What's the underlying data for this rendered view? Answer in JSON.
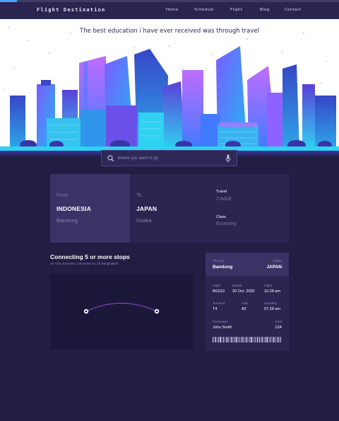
{
  "nav": {
    "brand": "Flight Destination",
    "links": [
      "Home",
      "Schedule",
      "Flight",
      "Blog",
      "Contact"
    ]
  },
  "hero": {
    "tagline": "The best education i have ever received was through travel"
  },
  "search": {
    "placeholder": "Where you want to go"
  },
  "route": {
    "from": {
      "label": "From",
      "country": "INDONESIA",
      "city": "Bandung"
    },
    "to": {
      "label": "To",
      "country": "JAPAN",
      "city": "Osaka"
    },
    "travel": {
      "label": "Travel",
      "value": "2 Adult"
    },
    "class": {
      "label": "Class",
      "value": "Economy"
    }
  },
  "connections": {
    "title": "Connecting 5 or more stops",
    "subtitle": "Air Asia, Emirates, Indonesia Air, Air Bangladesh"
  },
  "ticket": {
    "origin_label": "The City",
    "origin_city": "Bandung",
    "dest_label": "Osaka",
    "dest_country": "JAPAN",
    "flight_label": "Flight",
    "flight_value": "BG510",
    "depart_label": "Depart",
    "depart_value": "20 Oct. 2020",
    "flight_time_label": "Flight",
    "flight_time_value": "10.28 am",
    "terminal_label": "Terminal",
    "terminal_value": "T4",
    "gate_label": "Gate",
    "gate_value": "A2",
    "boarding_label": "Boarding",
    "boarding_value": "07.28 am",
    "passenger_label": "Passenger",
    "passenger_value": "John Smith",
    "seat_label": "Seat",
    "seat_value": "12A"
  },
  "colors": {
    "background": "#221d43",
    "navbar": "#2a2451",
    "card": "#2b2552",
    "card_highlight": "#3a3366",
    "accent": "#4aa3ff",
    "route_line": "#8a4fd8"
  }
}
